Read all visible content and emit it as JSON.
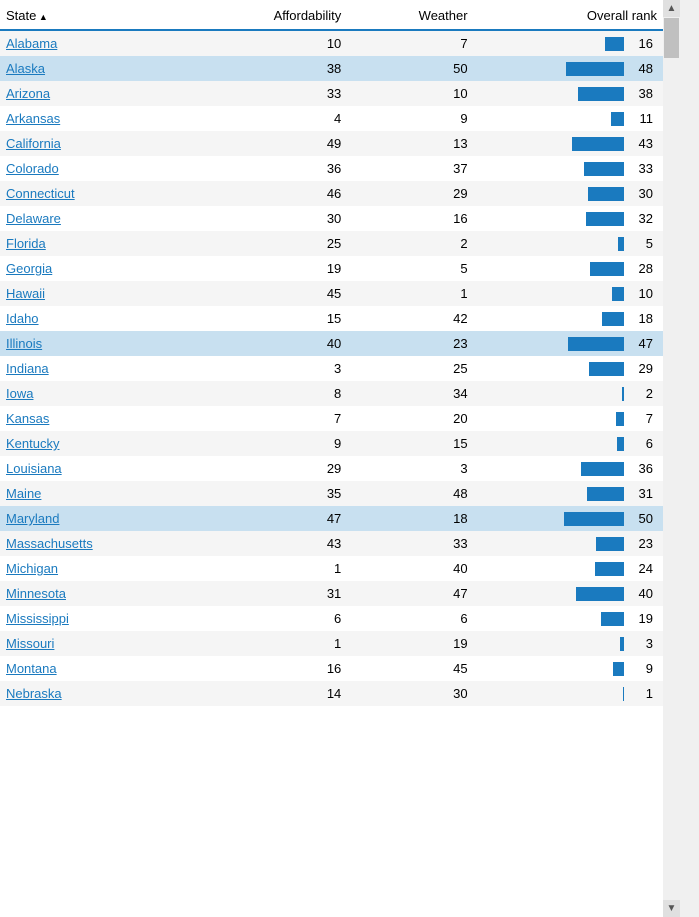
{
  "header": {
    "state_label": "State",
    "affordability_label": "Affordability",
    "weather_label": "Weather",
    "overall_rank_label": "Overall rank"
  },
  "rows": [
    {
      "state": "Alabama",
      "affordability": 10,
      "weather": 7,
      "rank": 16,
      "highlight": false
    },
    {
      "state": "Alaska",
      "affordability": 38,
      "weather": 50,
      "rank": 48,
      "highlight": true
    },
    {
      "state": "Arizona",
      "affordability": 33,
      "weather": 10,
      "rank": 38,
      "highlight": false
    },
    {
      "state": "Arkansas",
      "affordability": 4,
      "weather": 9,
      "rank": 11,
      "highlight": false
    },
    {
      "state": "California",
      "affordability": 49,
      "weather": 13,
      "rank": 43,
      "highlight": false
    },
    {
      "state": "Colorado",
      "affordability": 36,
      "weather": 37,
      "rank": 33,
      "highlight": false
    },
    {
      "state": "Connecticut",
      "affordability": 46,
      "weather": 29,
      "rank": 30,
      "highlight": false
    },
    {
      "state": "Delaware",
      "affordability": 30,
      "weather": 16,
      "rank": 32,
      "highlight": false
    },
    {
      "state": "Florida",
      "affordability": 25,
      "weather": 2,
      "rank": 5,
      "highlight": false
    },
    {
      "state": "Georgia",
      "affordability": 19,
      "weather": 5,
      "rank": 28,
      "highlight": false
    },
    {
      "state": "Hawaii",
      "affordability": 45,
      "weather": 1,
      "rank": 10,
      "highlight": false
    },
    {
      "state": "Idaho",
      "affordability": 15,
      "weather": 42,
      "rank": 18,
      "highlight": false
    },
    {
      "state": "Illinois",
      "affordability": 40,
      "weather": 23,
      "rank": 47,
      "highlight": true
    },
    {
      "state": "Indiana",
      "affordability": 3,
      "weather": 25,
      "rank": 29,
      "highlight": false
    },
    {
      "state": "Iowa",
      "affordability": 8,
      "weather": 34,
      "rank": 2,
      "highlight": false
    },
    {
      "state": "Kansas",
      "affordability": 7,
      "weather": 20,
      "rank": 7,
      "highlight": false
    },
    {
      "state": "Kentucky",
      "affordability": 9,
      "weather": 15,
      "rank": 6,
      "highlight": false
    },
    {
      "state": "Louisiana",
      "affordability": 29,
      "weather": 3,
      "rank": 36,
      "highlight": false
    },
    {
      "state": "Maine",
      "affordability": 35,
      "weather": 48,
      "rank": 31,
      "highlight": false
    },
    {
      "state": "Maryland",
      "affordability": 47,
      "weather": 18,
      "rank": 50,
      "highlight": true
    },
    {
      "state": "Massachusetts",
      "affordability": 43,
      "weather": 33,
      "rank": 23,
      "highlight": false
    },
    {
      "state": "Michigan",
      "affordability": 1,
      "weather": 40,
      "rank": 24,
      "highlight": false
    },
    {
      "state": "Minnesota",
      "affordability": 31,
      "weather": 47,
      "rank": 40,
      "highlight": false
    },
    {
      "state": "Mississippi",
      "affordability": 6,
      "weather": 6,
      "rank": 19,
      "highlight": false
    },
    {
      "state": "Missouri",
      "affordability": 1,
      "weather": 19,
      "rank": 3,
      "highlight": false
    },
    {
      "state": "Montana",
      "affordability": 16,
      "weather": 45,
      "rank": 9,
      "highlight": false
    },
    {
      "state": "Nebraska",
      "affordability": 14,
      "weather": 30,
      "rank": 1,
      "highlight": false
    }
  ],
  "max_rank": 50
}
